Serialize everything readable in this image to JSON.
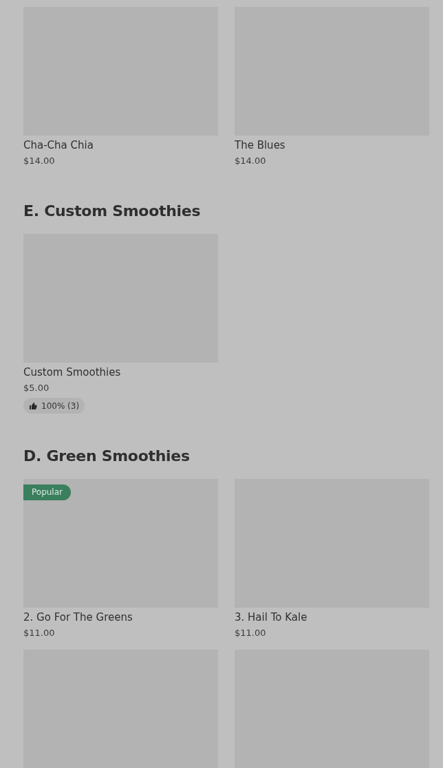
{
  "sections": [
    {
      "items": [
        {
          "kind": "card",
          "name": "Cha-Cha Chia",
          "price": "$14.00"
        },
        {
          "kind": "card",
          "name": "The Blues",
          "price": "$14.00"
        }
      ]
    },
    {
      "title": "E. Custom Smoothies",
      "items": [
        {
          "kind": "card",
          "name": "Custom Smoothies",
          "price": "$5.00",
          "rating": "100% (3)"
        }
      ]
    },
    {
      "title": "D. Green Smoothies",
      "items": [
        {
          "kind": "card",
          "name": "2. Go For The Greens",
          "price": "$11.00",
          "badge": "Popular"
        },
        {
          "kind": "card",
          "name": "3. Hail To Kale",
          "price": "$11.00"
        },
        {
          "kind": "card"
        },
        {
          "kind": "card"
        }
      ]
    }
  ]
}
